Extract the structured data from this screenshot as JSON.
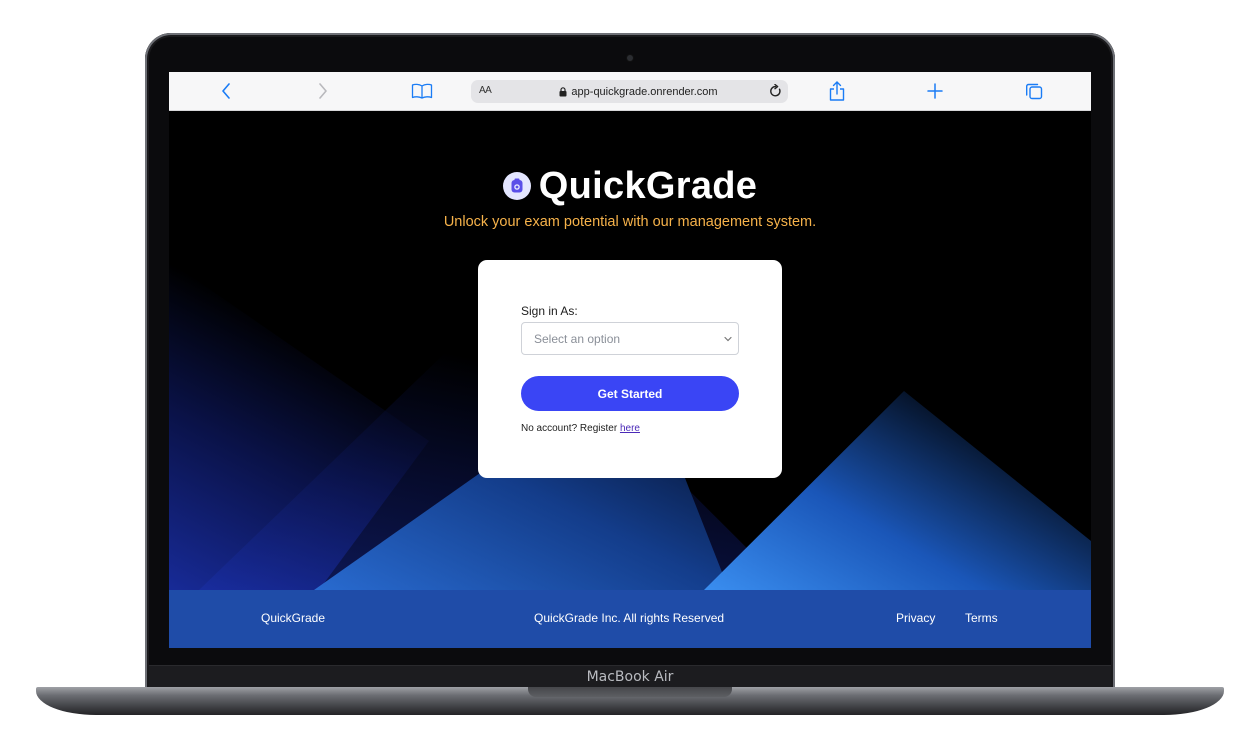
{
  "device": {
    "model_label": "MacBook Air"
  },
  "browser": {
    "text_size_label": "AA",
    "url": "app-quickgrade.onrender.com",
    "icons": {
      "back": "chevron-left-icon",
      "forward": "chevron-right-icon",
      "bookmarks": "book-icon",
      "lock": "lock-icon",
      "reload": "reload-icon",
      "share": "share-icon",
      "new_tab": "plus-icon",
      "tabs": "tabs-icon"
    },
    "accent_color": "#1a7cf5"
  },
  "header": {
    "brand_name": "QuickGrade",
    "tagline": "Unlock your exam potential with our management system.",
    "tagline_color": "#f6b24a"
  },
  "signin_card": {
    "label": "Sign in As:",
    "select_placeholder": "Select an option",
    "button_label": "Get Started",
    "button_color": "#3a45f5",
    "register_prompt": "No account? Register",
    "register_link": "here"
  },
  "footer": {
    "brand": "QuickGrade",
    "copyright": "QuickGrade Inc. All rights Reserved",
    "links": [
      "Privacy",
      "Terms"
    ],
    "background": "#1f4ca8"
  }
}
